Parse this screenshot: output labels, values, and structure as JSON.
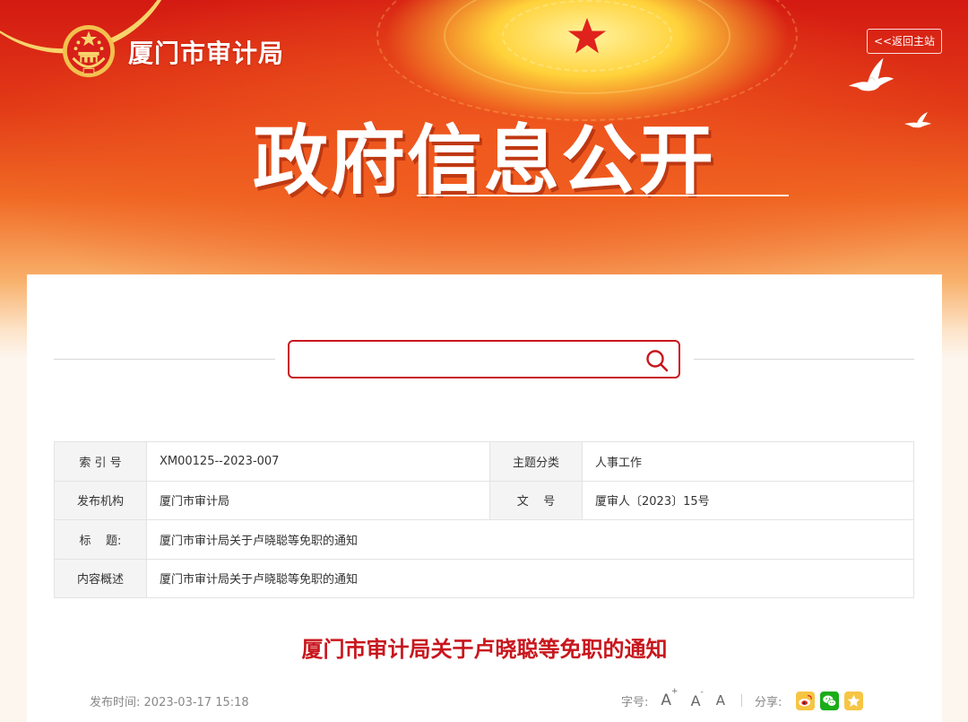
{
  "header": {
    "site_name": "厦门市审计局",
    "home_link": "<<返回主站",
    "hero_title": "政府信息公开"
  },
  "search": {
    "placeholder": "",
    "value": ""
  },
  "meta": {
    "index_label": "索 引 号",
    "index_value": "XM00125--2023-007",
    "topic_label": "主题分类",
    "topic_value": "人事工作",
    "issuer_label": "发布机构",
    "issuer_value": "厦门市审计局",
    "doc_no_label": "文    号",
    "doc_no_value": "厦审人〔2023〕15号",
    "title_label": "标    题:",
    "title_value": "厦门市审计局关于卢晓聪等免职的通知",
    "summary_label": "内容概述",
    "summary_value": "厦门市审计局关于卢晓聪等免职的通知"
  },
  "article": {
    "title": "厦门市审计局关于卢晓聪等免职的通知",
    "publish_label": "发布时间:",
    "publish_time": "2023-03-17 15:18",
    "font_size_label": "字号:",
    "font_large": "A",
    "font_medium": "A",
    "font_small": "A",
    "font_large_mark": "+",
    "font_medium_mark": "-",
    "share_label": "分享:"
  },
  "colors": {
    "brand_red": "#c8161d",
    "wechat_green": "#1aad19",
    "share_yellow": "#f6c543"
  },
  "icons": [
    "national-emblem-icon",
    "dove-icon",
    "search-icon",
    "weibo-icon",
    "wechat-icon",
    "qzone-icon"
  ]
}
